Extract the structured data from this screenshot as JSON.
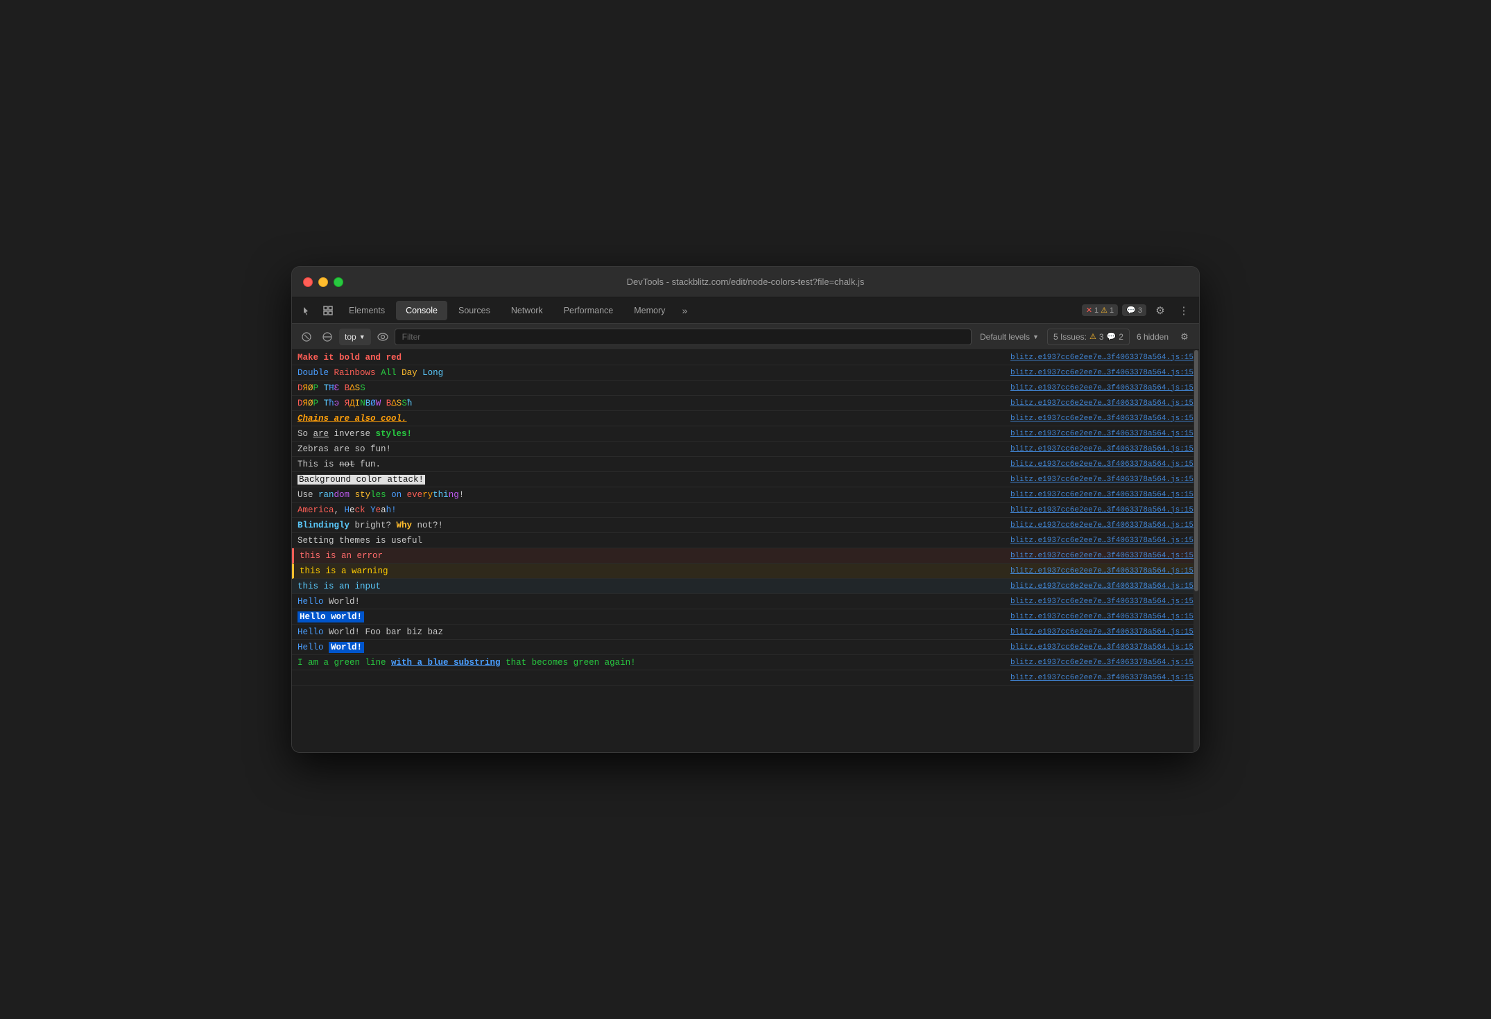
{
  "window": {
    "title": "DevTools - stackblitz.com/edit/node-colors-test?file=chalk.js"
  },
  "tabs": {
    "items": [
      {
        "label": "Elements",
        "active": false
      },
      {
        "label": "Console",
        "active": true
      },
      {
        "label": "Sources",
        "active": false
      },
      {
        "label": "Network",
        "active": false
      },
      {
        "label": "Performance",
        "active": false
      },
      {
        "label": "Memory",
        "active": false
      }
    ],
    "more_label": "»"
  },
  "badges": {
    "error_count": "1",
    "warning_count": "1",
    "info_count": "3",
    "issues_label": "5 Issues:",
    "issues_errors": "3",
    "issues_messages": "2",
    "hidden_label": "6 hidden"
  },
  "toolbar": {
    "top_label": "top",
    "filter_placeholder": "Filter",
    "levels_label": "Default levels"
  },
  "source": "blitz.e1937cc6e2ee7e…3f4063378a564.js:15",
  "console_rows": [
    {
      "id": 1,
      "type": "bold-red",
      "text_html": "<span class='c-red bold'>Make it bold and red</span>"
    },
    {
      "id": 2,
      "type": "rainbow-words",
      "text_html": "<span class='c-blue'>Double</span> <span class='c-red'>Rainbows</span> <span class='c-green'>All</span> <span class='c-yellow'>Day</span> <span class='c-cyan'>Long</span>"
    },
    {
      "id": 3,
      "type": "drop-bass",
      "text_html": "<span class='c-red'>D</span><span class='c-orange'>Я</span><span class='c-yellow'>Ø</span><span class='c-green'>P</span> <span class='c-cyan'>T</span><span class='c-blue'>Ħ</span><span class='c-magenta'>Ɛ</span> <span class='c-red'>B</span><span class='c-orange'>Δ</span><span class='c-yellow'>S</span><span class='c-green'>S</span>"
    },
    {
      "id": 4,
      "type": "drop-rainbow",
      "text_html": "<span class='c-red'>D</span><span class='c-orange'>Я</span><span class='c-yellow'>Ø</span><span class='c-green'>P</span> <span class='c-cyan'>T</span><span class='c-blue'>ħ</span><span class='c-magenta'>э</span> <span class='c-red'>Я</span><span class='c-orange'>Д</span><span class='c-yellow'>І</span><span class='c-green'>N</span><span class='c-cyan'>B</span><span class='c-blue'>Ø</span><span class='c-magenta'>W</span> <span class='c-red'>B</span><span class='c-orange'>Δ</span><span class='c-yellow'>S</span><span class='c-green'>S</span><span class='c-cyan'>ħ</span>"
    },
    {
      "id": 5,
      "type": "chains",
      "text_html": "<span class='c-orange italic bold underline'>Chains are also cool.</span>"
    },
    {
      "id": 6,
      "type": "inverse",
      "text_html": "<span class='c-default'>So </span><span class='c-default underline'>are</span><span class='c-default'> inverse </span><span class='c-green bold'>styles!</span>"
    },
    {
      "id": 7,
      "type": "zebras",
      "text_html": "<span class='c-default'>Zebras are so fun!</span>"
    },
    {
      "id": 8,
      "type": "not-fun",
      "text_html": "<span class='c-default'>This is </span><span class='c-default strikethrough'>not</span><span class='c-default'> fun.</span>"
    },
    {
      "id": 9,
      "type": "bg-attack",
      "text_html": "<span class='bg-black-on-white'>Background color attack!</span>"
    },
    {
      "id": 10,
      "type": "random",
      "text_html": "<span class='c-default'>Use </span><span class='c-cyan'>ran</span><span class='c-magenta'>dom</span><span class='c-default'> </span><span class='c-yellow'>sty</span><span class='c-green'>les</span><span class='c-default'> </span><span class='c-red'>on</span><span class='c-default'> </span><span class='c-blue'>eve</span><span class='c-orange'>ry</span><span class='c-cyan'>thi</span><span class='c-magenta'>ng</span><span class='c-default'>!</span>"
    },
    {
      "id": 11,
      "type": "america",
      "text_html": "<span class='c-red'>America</span><span class='c-default'>, </span><span class='c-blue'>H</span><span class='c-white'>e</span><span class='c-red'>ck</span><span class='c-default'> </span><span class='c-blue'>Y</span><span class='c-red'>e</span><span class='c-white'>a</span><span class='c-blue'>h</span><span class='c-default'>!</span>"
    },
    {
      "id": 12,
      "type": "bright",
      "text_html": "<span class='c-cyan bold'>Blindingly</span><span class='c-default'> bright? </span><span class='c-yellow bold'>Why</span><span class='c-default'> not?!</span>"
    },
    {
      "id": 13,
      "type": "themes",
      "text_html": "<span class='c-default'>Setting themes is useful</span>"
    },
    {
      "id": 14,
      "type": "error-row",
      "text_html": "<span class='c-error'>this is an error</span>"
    },
    {
      "id": 15,
      "type": "warning-row",
      "text_html": "<span class='c-warning'>this is a warning</span>"
    },
    {
      "id": 16,
      "type": "input-row",
      "text_html": "<span class='c-input'>this is an input</span>"
    },
    {
      "id": 17,
      "type": "hello-world",
      "text_html": "<span class='c-blue'>Hello</span><span class='c-default'> World!</span>"
    },
    {
      "id": 18,
      "type": "hello-world-bg",
      "text_html": "<span class='bg-blue c-white bold'>Hello world!</span>"
    },
    {
      "id": 19,
      "type": "hello-foo",
      "text_html": "<span class='c-blue'>Hello</span><span class='c-default'> World! Foo bar biz baz</span>"
    },
    {
      "id": 20,
      "type": "hello-world2",
      "text_html": "<span class='c-blue'>Hello</span><span class='c-default'> </span><span class='bg-blue c-white bold'>World!</span>"
    },
    {
      "id": 21,
      "type": "green-blue",
      "text_html": "<span class='c-green'>I am a green line </span><span class='c-blue underline bold'>with a blue substring</span><span class='c-green'> that becomes green again!</span>"
    },
    {
      "id": 22,
      "type": "more",
      "text_html": ""
    }
  ]
}
